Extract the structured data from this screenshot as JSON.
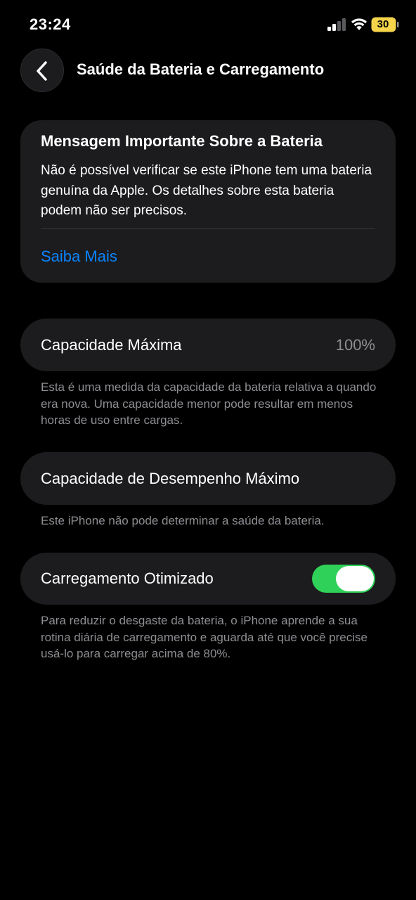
{
  "status_bar": {
    "time": "23:24",
    "battery_level": "30",
    "battery_color": "#f5d34a"
  },
  "header": {
    "title": "Saúde da Bateria e Carregamento",
    "back_icon": "chevron-left-icon"
  },
  "message_card": {
    "title": "Mensagem Importante Sobre a Bateria",
    "body": "Não é possível verificar se este iPhone tem uma bateria genuína da Apple. Os detalhes sobre esta bateria podem não ser precisos.",
    "link_label": "Saiba Mais",
    "link_color": "#0a84ff"
  },
  "max_capacity": {
    "label": "Capacidade Máxima",
    "value": "100%",
    "note": "Esta é uma medida da capacidade da bateria relativa a quando era nova. Uma capacidade menor pode resultar em menos horas de uso entre cargas."
  },
  "peak_performance": {
    "label": "Capacidade de Desempenho Máximo",
    "note": "Este iPhone não pode determinar a saúde da bateria."
  },
  "optimized_charging": {
    "label": "Carregamento Otimizado",
    "enabled": true,
    "toggle_color": "#30d158",
    "note": "Para reduzir o desgaste da bateria, o iPhone aprende a sua rotina diária de carregamento e aguarda até que você precise usá-lo para carregar acima de 80%."
  }
}
